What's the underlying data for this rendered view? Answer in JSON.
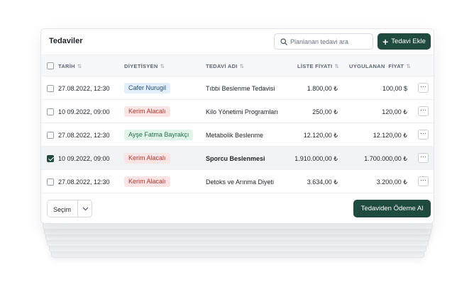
{
  "header": {
    "title": "Tedaviler",
    "search_placeholder": "Planlanan tedavi ara",
    "add_label": "Tedavi Ekle"
  },
  "columns": {
    "date": "TARİH",
    "dietitian": "DİYETİSYEN",
    "treatment": "TEDAVİ ADI",
    "list_price": "LİSTE FİYATI",
    "applied_price": "UYGULANAN  FİYAT",
    "sort_icon": "⇅"
  },
  "rows": [
    {
      "date": "27.08.2022, 12:30",
      "dietitian": "Cafer Nurugil",
      "dietitian_color": "blue",
      "treatment": "Tıbbi Beslenme Tedavisi",
      "list_price": "1.800,00 ₺",
      "applied_price": "100,00 $",
      "selected": false
    },
    {
      "date": "10 09.2022, 09:00",
      "dietitian": "Kerim Alacalı",
      "dietitian_color": "red",
      "treatment": "Kilo Yönetimi Programları",
      "list_price": "250,00 ₺",
      "applied_price": "120,00 ₺",
      "selected": false
    },
    {
      "date": "27.08.2022, 12:30",
      "dietitian": "Ayşe Fatma Bayrakçı",
      "dietitian_color": "green",
      "treatment": "Metabolik Beslenme",
      "list_price": "12.120,00 ₺",
      "applied_price": "12.120,00 ₺",
      "selected": false
    },
    {
      "date": "10 09.2022, 09:00",
      "dietitian": "Kerim Alacalı",
      "dietitian_color": "red",
      "treatment": "Sporcu Beslenmesi",
      "list_price": "1.910.000,00 ₺",
      "applied_price": "1.700.000,00 ₺",
      "selected": true
    },
    {
      "date": "27.08.2022, 12:30",
      "dietitian": "Kerim Alacalı",
      "dietitian_color": "red",
      "treatment": "Detoks ve Arınma Diyeti",
      "list_price": "3.634,00 ₺",
      "applied_price": "3.200,00 ₺",
      "selected": false
    }
  ],
  "row_menu_label": "···",
  "footer": {
    "select_value": "Seçim",
    "pay_label": "Tedaviden Ödeme Al"
  },
  "colors": {
    "accent": "#1f4a3f",
    "badge_blue": "#e3eefb",
    "badge_red": "#fbe4e4",
    "badge_green": "#e1f4e8"
  },
  "icons": {
    "search": "search-icon",
    "add": "plus-icon",
    "sort": "sort-icon",
    "more": "more-icon",
    "dropdown": "chevron-down-icon"
  }
}
